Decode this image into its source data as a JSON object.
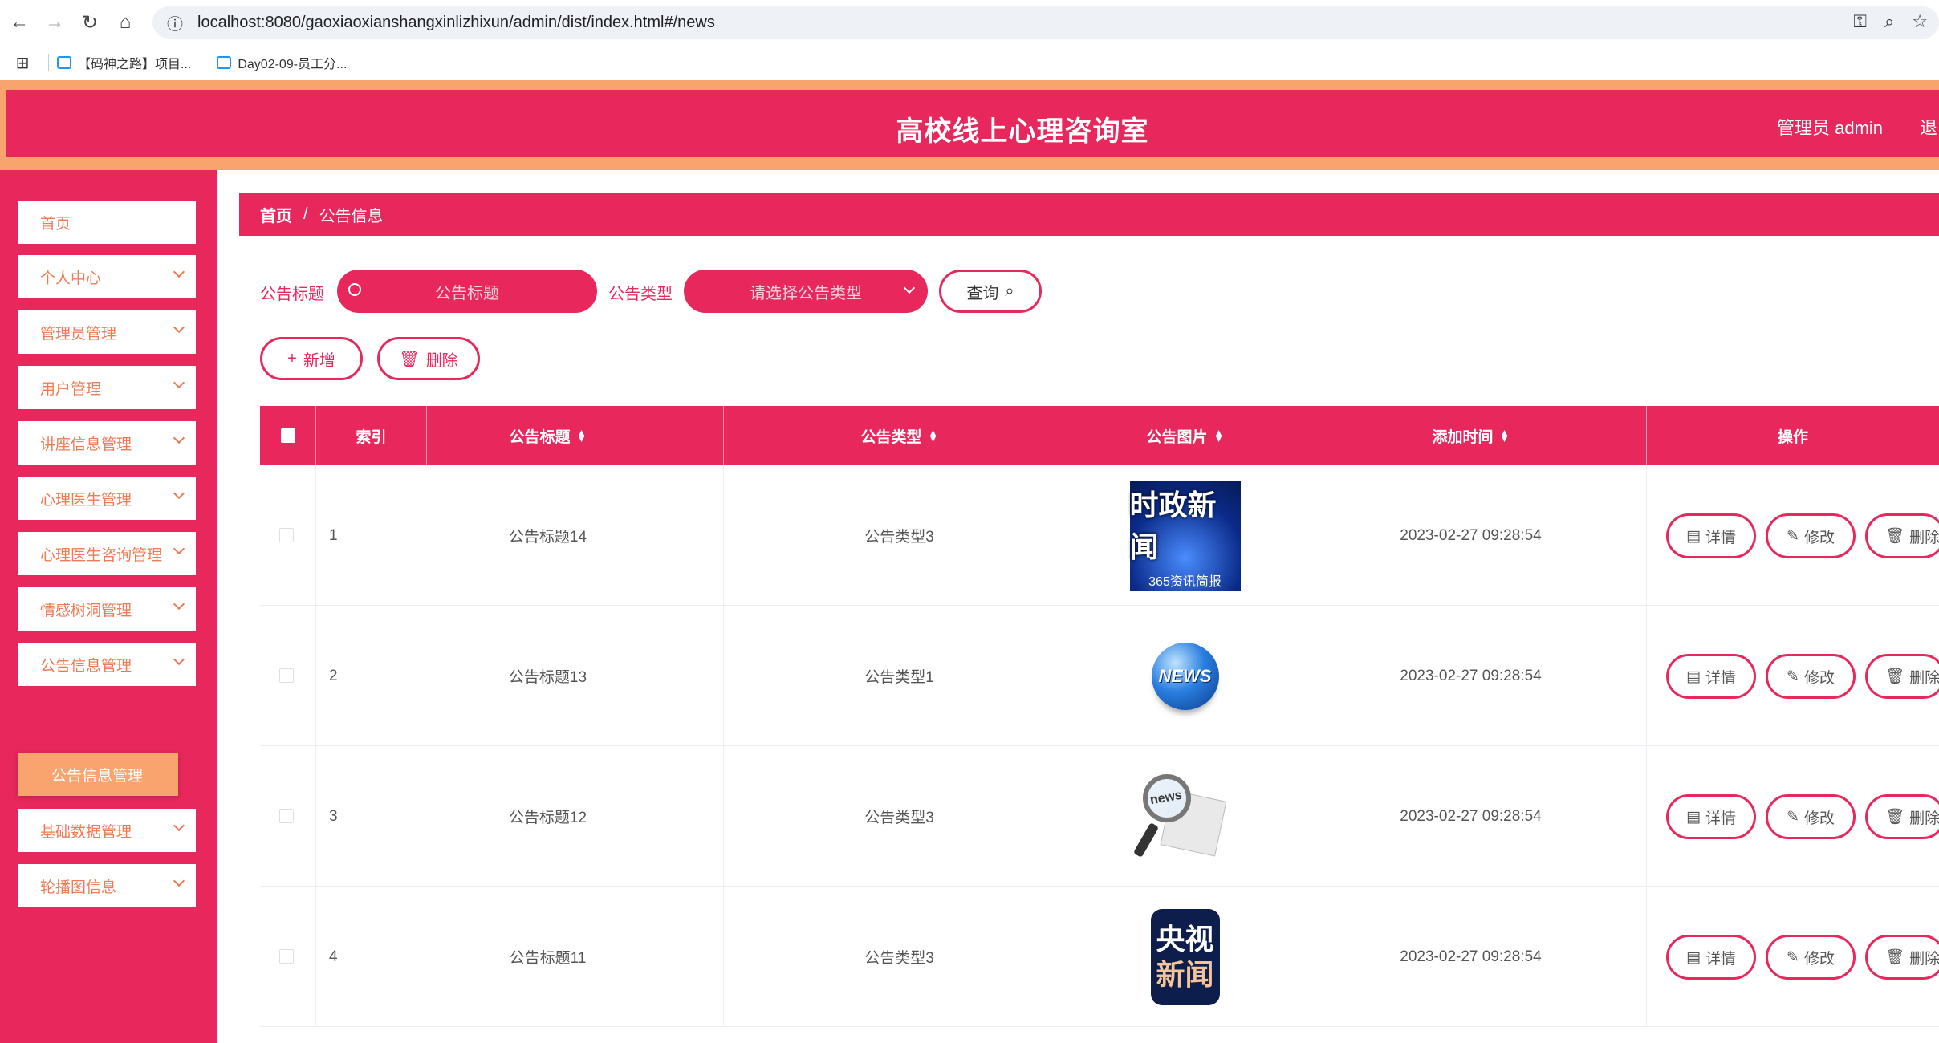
{
  "browser": {
    "url": "localhost:8080/gaoxiaoxianshangxinlizhixun/admin/dist/index.html#/news",
    "bookmarks": [
      "【码神之路】项目...",
      "Day02-09-员工分..."
    ]
  },
  "header": {
    "title": "高校线上心理咨询室",
    "admin_label": "管理员 admin",
    "logout_label": "退出"
  },
  "sidebar": {
    "items": [
      {
        "label": "首页",
        "chevron": false
      },
      {
        "label": "个人中心",
        "chevron": true
      },
      {
        "label": "管理员管理",
        "chevron": true
      },
      {
        "label": "用户管理",
        "chevron": true
      },
      {
        "label": "讲座信息管理",
        "chevron": true
      },
      {
        "label": "心理医生管理",
        "chevron": true
      },
      {
        "label": "心理医生咨询管理",
        "chevron": true
      },
      {
        "label": "情感树洞管理",
        "chevron": true
      },
      {
        "label": "公告信息管理",
        "chevron": true
      },
      {
        "label": "基础数据管理",
        "chevron": true
      },
      {
        "label": "轮播图信息",
        "chevron": true
      }
    ],
    "active_sub": "公告信息管理"
  },
  "breadcrumb": {
    "home": "首页",
    "sep": "/",
    "current": "公告信息"
  },
  "search": {
    "title_label": "公告标题",
    "title_placeholder": "公告标题",
    "type_label": "公告类型",
    "type_placeholder": "请选择公告类型",
    "query_label": "查询"
  },
  "actions": {
    "add_label": "新增",
    "delete_label": "删除"
  },
  "table": {
    "columns": [
      "索引",
      "公告标题",
      "公告类型",
      "公告图片",
      "添加时间",
      "操作"
    ],
    "rows": [
      {
        "index": "1",
        "title": "公告标题14",
        "type": "公告类型3",
        "image": "时政新闻",
        "image_sub": "365资讯简报",
        "time": "2023-02-27 09:28:54"
      },
      {
        "index": "2",
        "title": "公告标题13",
        "type": "公告类型1",
        "image": "NEWS",
        "time": "2023-02-27 09:28:54"
      },
      {
        "index": "3",
        "title": "公告标题12",
        "type": "公告类型3",
        "image": "news",
        "time": "2023-02-27 09:28:54"
      },
      {
        "index": "4",
        "title": "公告标题11",
        "type": "公告类型3",
        "image": "央视",
        "image_sub": "新闻",
        "time": "2023-02-27 09:28:54"
      }
    ],
    "row_actions": {
      "detail": "详情",
      "edit": "修改",
      "delete": "删除"
    }
  },
  "colors": {
    "primary": "#e8285c",
    "accent": "#f9a36e",
    "menu_text": "#f07a55"
  }
}
